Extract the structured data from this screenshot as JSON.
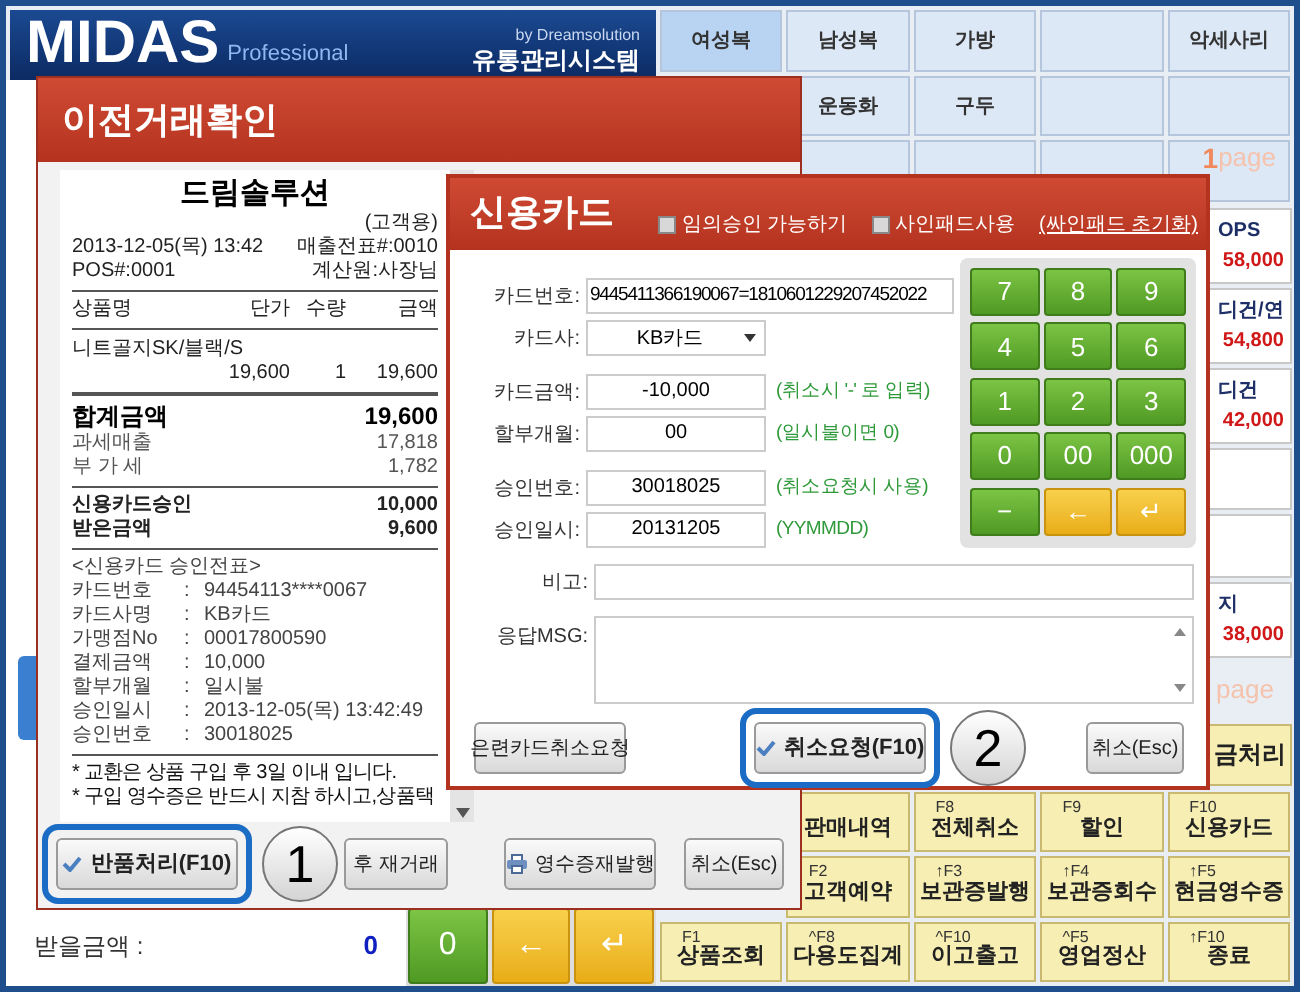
{
  "header": {
    "logo": "MIDAS",
    "edition": "Professional",
    "vendor": "by Dreamsolution",
    "system": "유통관리시스템"
  },
  "category_rows": [
    [
      {
        "kind": "button",
        "label": "여성복",
        "selected": true
      },
      {
        "kind": "button",
        "label": "남성복",
        "selected": false
      },
      {
        "kind": "button",
        "label": "가방",
        "selected": false
      },
      {
        "kind": "blank",
        "selected": false
      },
      {
        "kind": "button",
        "label": "악세사리",
        "selected": false
      }
    ],
    [
      {
        "kind": "button",
        "label": "운동화",
        "selected": false
      },
      {
        "kind": "button",
        "label": "구두",
        "selected": false
      },
      {
        "kind": "blank",
        "selected": false
      },
      {
        "kind": "blank",
        "selected": false
      }
    ],
    [
      {
        "kind": "blank",
        "selected": false
      },
      {
        "kind": "blank",
        "selected": false
      },
      {
        "kind": "blank",
        "selected": false
      },
      {
        "kind": "page",
        "number": "1",
        "label": "page",
        "selected": false
      }
    ]
  ],
  "side_slots": [
    {
      "kind": "product",
      "name": "OPS",
      "price": "58,000"
    },
    {
      "kind": "product",
      "name": "디건/연",
      "price": "54,800"
    },
    {
      "kind": "product",
      "name": "디건",
      "price": "42,000"
    },
    {
      "kind": "blank"
    },
    {
      "kind": "blank"
    },
    {
      "kind": "product",
      "name": "지",
      "price": "38,000"
    },
    {
      "kind": "page",
      "label": "page"
    },
    {
      "kind": "action",
      "label": "금처리"
    }
  ],
  "function_rows": [
    [
      {
        "label": "판매내역"
      },
      {
        "shortcut": "F8",
        "label": "전체취소"
      },
      {
        "shortcut": "F9",
        "label": "할인"
      },
      {
        "shortcut": "F10",
        "label": "신용카드"
      }
    ],
    [
      {
        "shortcut": "F2",
        "label": "고객예약"
      },
      {
        "shortcut": "↑F3",
        "label": "보관증발행"
      },
      {
        "shortcut": "↑F4",
        "label": "보관증회수"
      },
      {
        "shortcut": "↑F5",
        "label": "현금영수증"
      }
    ],
    [
      {
        "shortcut": "F1",
        "label": "상품조회"
      },
      {
        "shortcut": "^F8",
        "label": "다용도집계"
      },
      {
        "shortcut": "^F10",
        "label": "이고출고"
      },
      {
        "shortcut": "^F5",
        "label": "영업정산"
      },
      {
        "shortcut": "↑F10",
        "label": "종료"
      }
    ]
  ],
  "amount_due": {
    "label": "받을금액 :",
    "value": "0"
  },
  "bottom_keys": [
    {
      "kind": "digit",
      "label": "0"
    },
    {
      "kind": "nav",
      "label": "←"
    },
    {
      "kind": "nav",
      "label": "↵"
    }
  ],
  "history_dialog": {
    "title": "이전거래확인",
    "receipt": {
      "store": "드림솔루션",
      "copy": "(고객용)",
      "datetime": "2013-12-05(목) 13:42",
      "slip_no": "매출전표#:0010",
      "pos": "POS#:0001",
      "cashier": "계산원:사장님",
      "columns": [
        "상품명",
        "단가",
        "수량",
        "금액"
      ],
      "items": [
        {
          "name": "니트골지SK/블랙/S",
          "price": "19,600",
          "qty": "1",
          "amount": "19,600"
        }
      ],
      "total": {
        "label": "합계금액",
        "value": "19,600"
      },
      "tax_lines": [
        {
          "label": "과세매출",
          "value": "17,818"
        },
        {
          "label": "부 가 세",
          "value": "1,782"
        }
      ],
      "payments": [
        {
          "label": "신용카드승인",
          "value": "10,000"
        },
        {
          "label": "받은금액",
          "value": "9,600"
        }
      ],
      "slip_title": "<신용카드 승인전표>",
      "slip_lines": [
        {
          "label": "카드번호",
          "separator": ":",
          "value": "94454113****0067"
        },
        {
          "label": "카드사명",
          "separator": ":",
          "value": "KB카드"
        },
        {
          "label": "가맹점No",
          "separator": ":",
          "value": "00017800590"
        },
        {
          "label": "결제금액",
          "separator": ":",
          "value": "10,000"
        },
        {
          "label": "할부개월",
          "separator": ":",
          "value": "일시불"
        },
        {
          "label": "승인일시",
          "separator": ":",
          "value": "2013-12-05(목) 13:42:49"
        },
        {
          "label": "승인번호",
          "separator": ":",
          "value": "30018025"
        }
      ],
      "notes": [
        "* 교환은 상품 구입 후 3일 이내 입니다.",
        "* 구입 영수증은 반드시 지참 하시고,상품택"
      ]
    },
    "buttons": [
      {
        "kind": "confirm",
        "label": "반품처리(F10)",
        "highlighted": true,
        "callout": "1"
      },
      {
        "kind": "plain",
        "label": "후 재거래",
        "highlighted": false
      },
      {
        "kind": "print",
        "label": "영수증재발행",
        "highlighted": false
      },
      {
        "kind": "plain",
        "label": "취소(Esc)",
        "highlighted": false
      }
    ]
  },
  "card_dialog": {
    "title": "신용카드",
    "options": [
      {
        "label": "임의승인 가능하기",
        "checked": false
      },
      {
        "label": "사인패드사용",
        "checked": false
      }
    ],
    "link": "(싸인패드 초기화)",
    "field_groups": [
      [
        {
          "kind": "wide",
          "label": "카드번호:",
          "value": "9445411366190067=1810601229207452022"
        },
        {
          "kind": "select",
          "label": "카드사:",
          "value": "KB카드"
        }
      ],
      [
        {
          "kind": "text",
          "label": "카드금액:",
          "value": "-10,000",
          "hint": "(취소시 '-' 로 입력)"
        },
        {
          "kind": "text",
          "label": "할부개월:",
          "value": "00",
          "hint": "(일시불이면 0)"
        }
      ],
      [
        {
          "kind": "text",
          "label": "승인번호:",
          "value": "30018025",
          "hint": "(취소요청시 사용)"
        },
        {
          "kind": "text",
          "label": "승인일시:",
          "value": "20131205",
          "hint": "(YYMMDD)"
        }
      ]
    ],
    "keypad": [
      {
        "kind": "digit",
        "label": "7"
      },
      {
        "kind": "digit",
        "label": "8"
      },
      {
        "kind": "digit",
        "label": "9"
      },
      {
        "kind": "digit",
        "label": "4"
      },
      {
        "kind": "digit",
        "label": "5"
      },
      {
        "kind": "digit",
        "label": "6"
      },
      {
        "kind": "digit",
        "label": "1"
      },
      {
        "kind": "digit",
        "label": "2"
      },
      {
        "kind": "digit",
        "label": "3"
      },
      {
        "kind": "digit",
        "label": "0"
      },
      {
        "kind": "digit",
        "label": "00"
      },
      {
        "kind": "digit",
        "label": "000"
      },
      {
        "kind": "digit",
        "label": "−"
      },
      {
        "kind": "nav",
        "label": "←"
      },
      {
        "kind": "nav",
        "label": "↵"
      }
    ],
    "memo": {
      "label": "비고:"
    },
    "response": {
      "label": "응답MSG:"
    },
    "buttons": [
      {
        "kind": "plain",
        "label": "은련카드취소요청",
        "highlighted": false
      },
      {
        "kind": "confirm",
        "label": "취소요청(F10)",
        "highlighted": true,
        "callout": "2"
      },
      {
        "kind": "plain",
        "label": "취소(Esc)",
        "highlighted": false
      }
    ]
  }
}
